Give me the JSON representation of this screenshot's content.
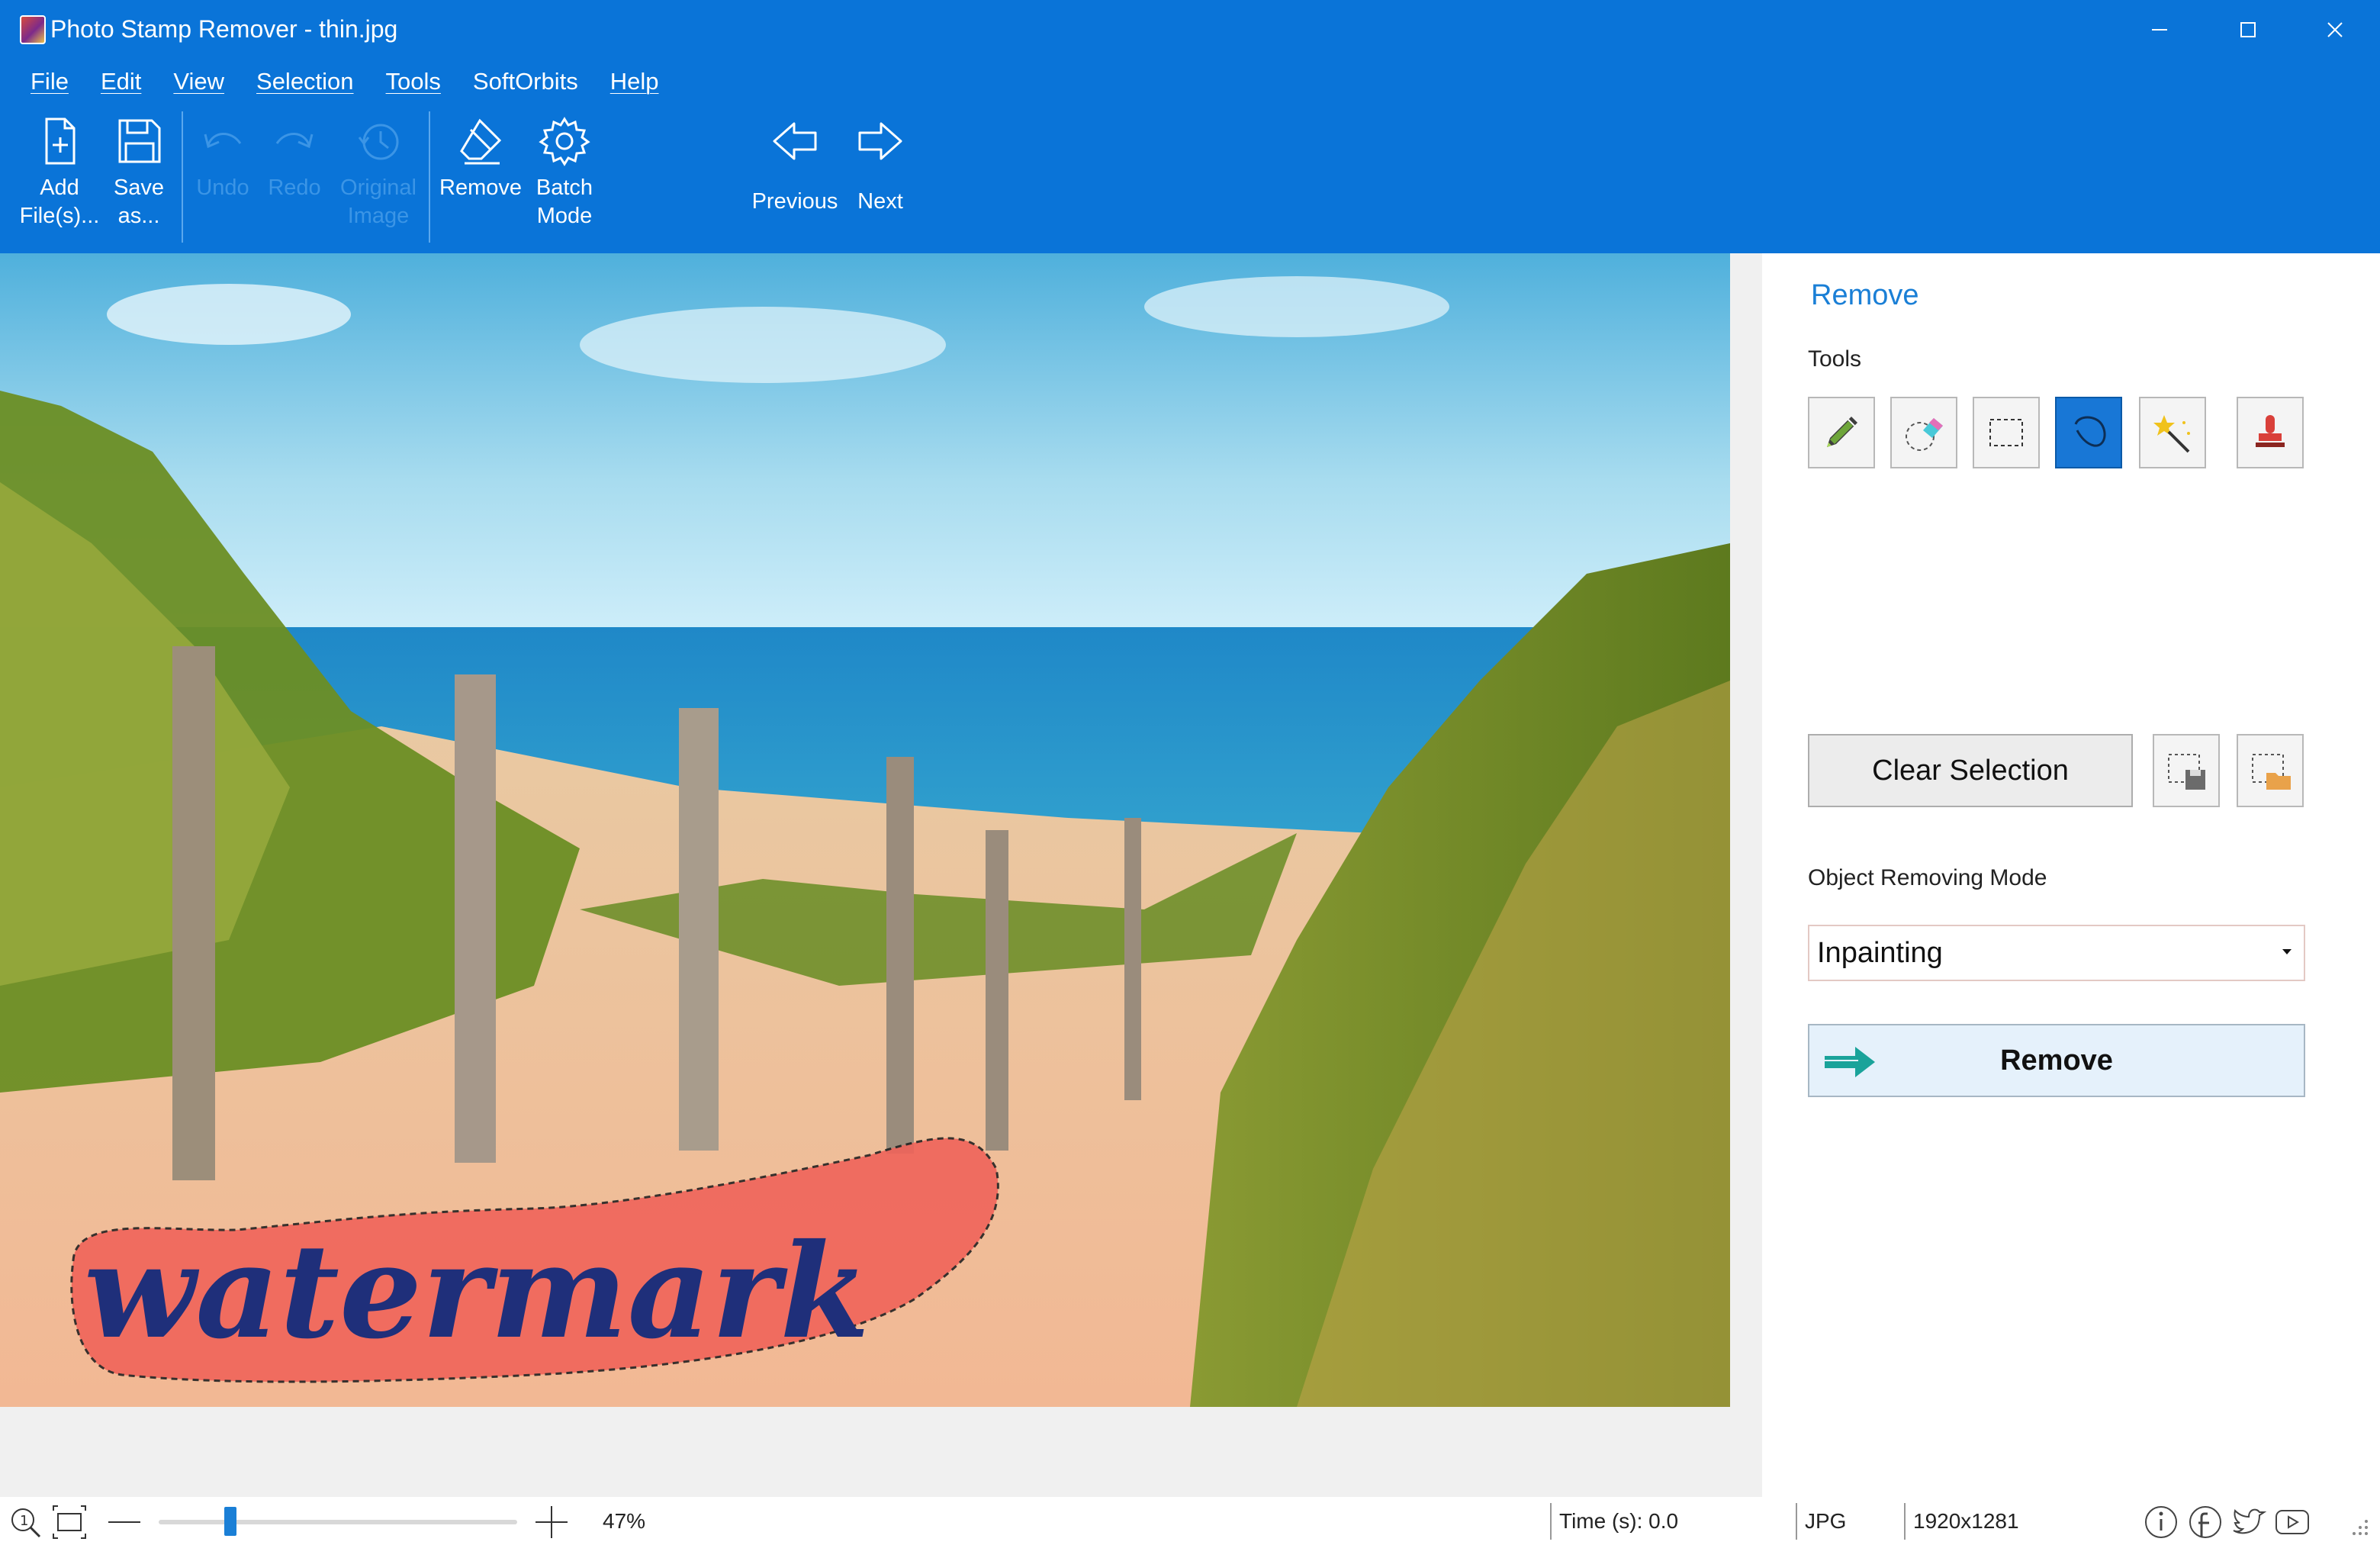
{
  "window": {
    "title": "Photo Stamp Remover - thin.jpg"
  },
  "menu": [
    "File",
    "Edit",
    "View",
    "Selection",
    "Tools",
    "SoftOrbits",
    "Help"
  ],
  "toolbar": {
    "add_files": [
      "Add",
      "File(s)..."
    ],
    "save_as": [
      "Save",
      "as..."
    ],
    "undo": "Undo",
    "redo": "Redo",
    "original_image": [
      "Original",
      "Image"
    ],
    "remove": "Remove",
    "batch_mode": [
      "Batch",
      "Mode"
    ],
    "previous": "Previous",
    "next": "Next"
  },
  "image": {
    "watermark_text": "watermark"
  },
  "panel": {
    "title": "Remove",
    "tools_label": "Tools",
    "tools": [
      "pencil-icon",
      "eraser-icon",
      "rect-select-icon",
      "lasso-icon",
      "magic-wand-icon",
      "stamp-icon"
    ],
    "active_tool": "lasso-icon",
    "clear_selection": "Clear Selection",
    "mode_label": "Object Removing Mode",
    "mode_value": "Inpainting",
    "remove_button": "Remove"
  },
  "status": {
    "zoom": "47%",
    "zoom_fraction": 0.2,
    "time": "Time (s): 0.0",
    "format": "JPG",
    "dimensions": "1920x1281"
  },
  "colors": {
    "accent": "#0a74d8",
    "selection_fill": "#f0645a",
    "watermark": "#1f2f7a"
  }
}
